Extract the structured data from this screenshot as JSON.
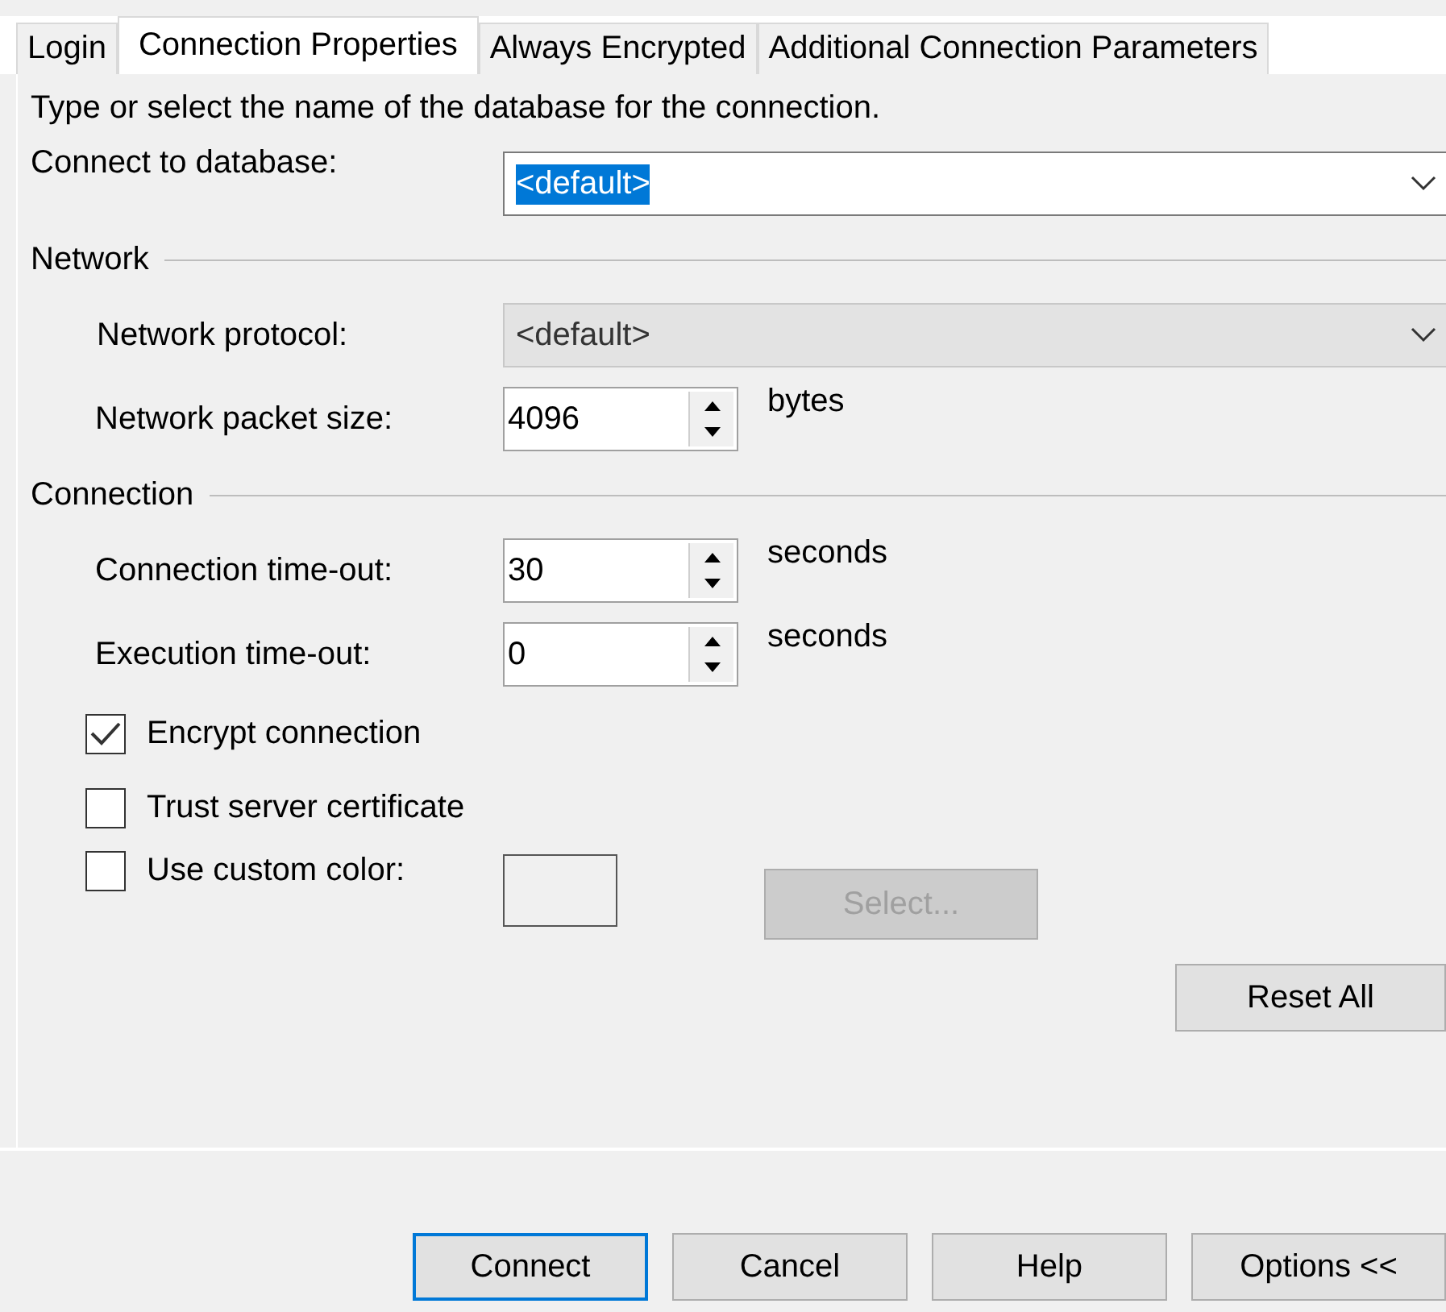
{
  "tabs": [
    {
      "label": "Login",
      "selected": false
    },
    {
      "label": "Connection Properties",
      "selected": true
    },
    {
      "label": "Always Encrypted",
      "selected": false
    },
    {
      "label": "Additional Connection Parameters",
      "selected": false
    }
  ],
  "description": "Type or select the name of the database for the connection.",
  "database": {
    "label": "Connect to database:",
    "value": "<default>",
    "text_selected": true
  },
  "network": {
    "title": "Network",
    "protocol": {
      "label": "Network protocol:",
      "value": "<default>",
      "disabled": true
    },
    "packet_size": {
      "label": "Network packet size:",
      "value": "4096",
      "unit": "bytes"
    }
  },
  "connection": {
    "title": "Connection",
    "timeouts": [
      {
        "label": "Connection time-out:",
        "value": "30",
        "unit": "seconds"
      },
      {
        "label": "Execution time-out:",
        "value": "0",
        "unit": "seconds"
      }
    ]
  },
  "checkboxes": [
    {
      "kind": "plain",
      "label": "Encrypt connection",
      "checked": true
    },
    {
      "kind": "plain",
      "label": "Trust server certificate",
      "checked": false
    },
    {
      "kind": "color",
      "label": "Use custom color:",
      "checked": false
    }
  ],
  "select_button": {
    "label": "Select...",
    "disabled": true
  },
  "reset_button": "Reset All",
  "footer_buttons": [
    {
      "label": "Connect",
      "default": true
    },
    {
      "label": "Cancel",
      "default": false
    },
    {
      "label": "Help",
      "default": false
    },
    {
      "label": "Options <<",
      "default": false
    }
  ]
}
